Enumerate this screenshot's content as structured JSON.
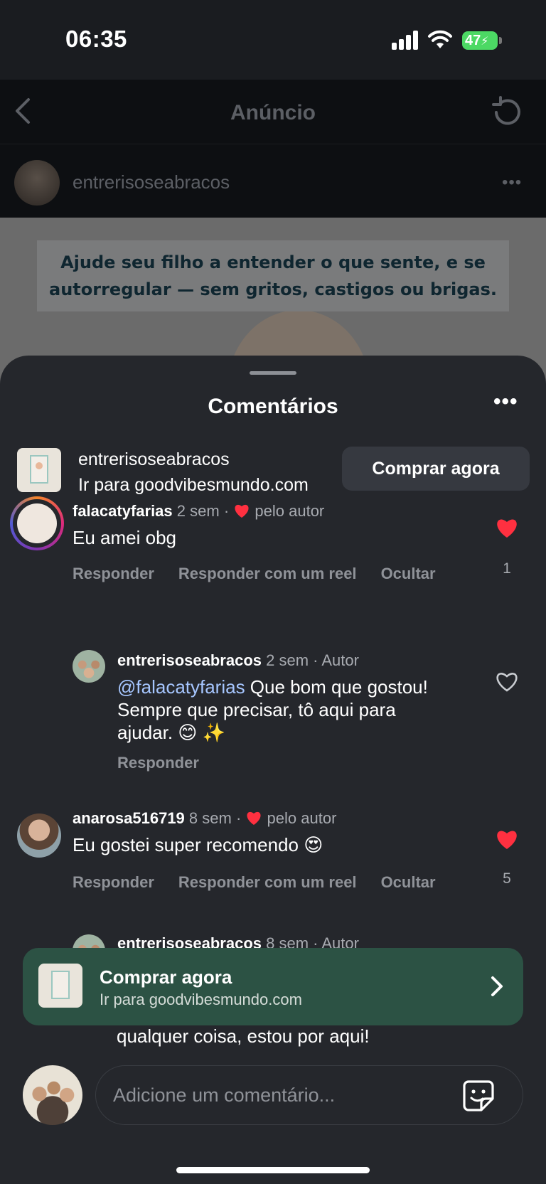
{
  "status": {
    "time": "06:35",
    "battery": "47"
  },
  "nav": {
    "title": "Anúncio"
  },
  "post": {
    "username": "entrerisoseabracos",
    "more": "•••",
    "caption_line1": "Ajude seu filho a entender o que sente, e se",
    "caption_line2": "autorregular — sem gritos, castigos ou brigas."
  },
  "sheet": {
    "title": "Comentários",
    "more": "•••"
  },
  "ad": {
    "username": "entrerisoseabracos",
    "link": "Ir para goodvibesmundo.com",
    "button": "Comprar agora"
  },
  "comments": [
    {
      "username": "falacatyfarias",
      "time": "2 sem",
      "sep": "·",
      "liked_label": "pelo autor",
      "text": "Eu amei obg",
      "actions": [
        "Responder",
        "Responder com um reel",
        "Ocultar"
      ],
      "likes": "1"
    },
    {
      "username": "entrerisoseabracos",
      "time": "2 sem · Autor",
      "mention": "@falacatyfarias",
      "text_a": " Que bom que gostou!",
      "text_b": "Sempre que precisar, tô aqui para",
      "text_c": "ajudar. 😊 ✨",
      "actions": [
        "Responder"
      ]
    },
    {
      "username": "anarosa516719",
      "time": "8 sem",
      "sep": "·",
      "liked_label": "pelo autor",
      "text": "Eu gostei super recomendo 😍",
      "actions": [
        "Responder",
        "Responder com um reel",
        "Ocultar"
      ],
      "likes": "5"
    },
    {
      "username": "entrerisoseabracos",
      "time": "8 sem · Autor",
      "text_trailing": "qualquer coisa, estou por aqui!"
    }
  ],
  "shopbar": {
    "title": "Comprar agora",
    "subtitle": "Ir para goodvibesmundo.com"
  },
  "composer": {
    "placeholder": "Adicione um comentário..."
  },
  "colors": {
    "sheet_bg": "#25272c",
    "shop_green": "#2c5244",
    "like_red": "#ff3040",
    "mention_blue": "#a6c6ff"
  }
}
